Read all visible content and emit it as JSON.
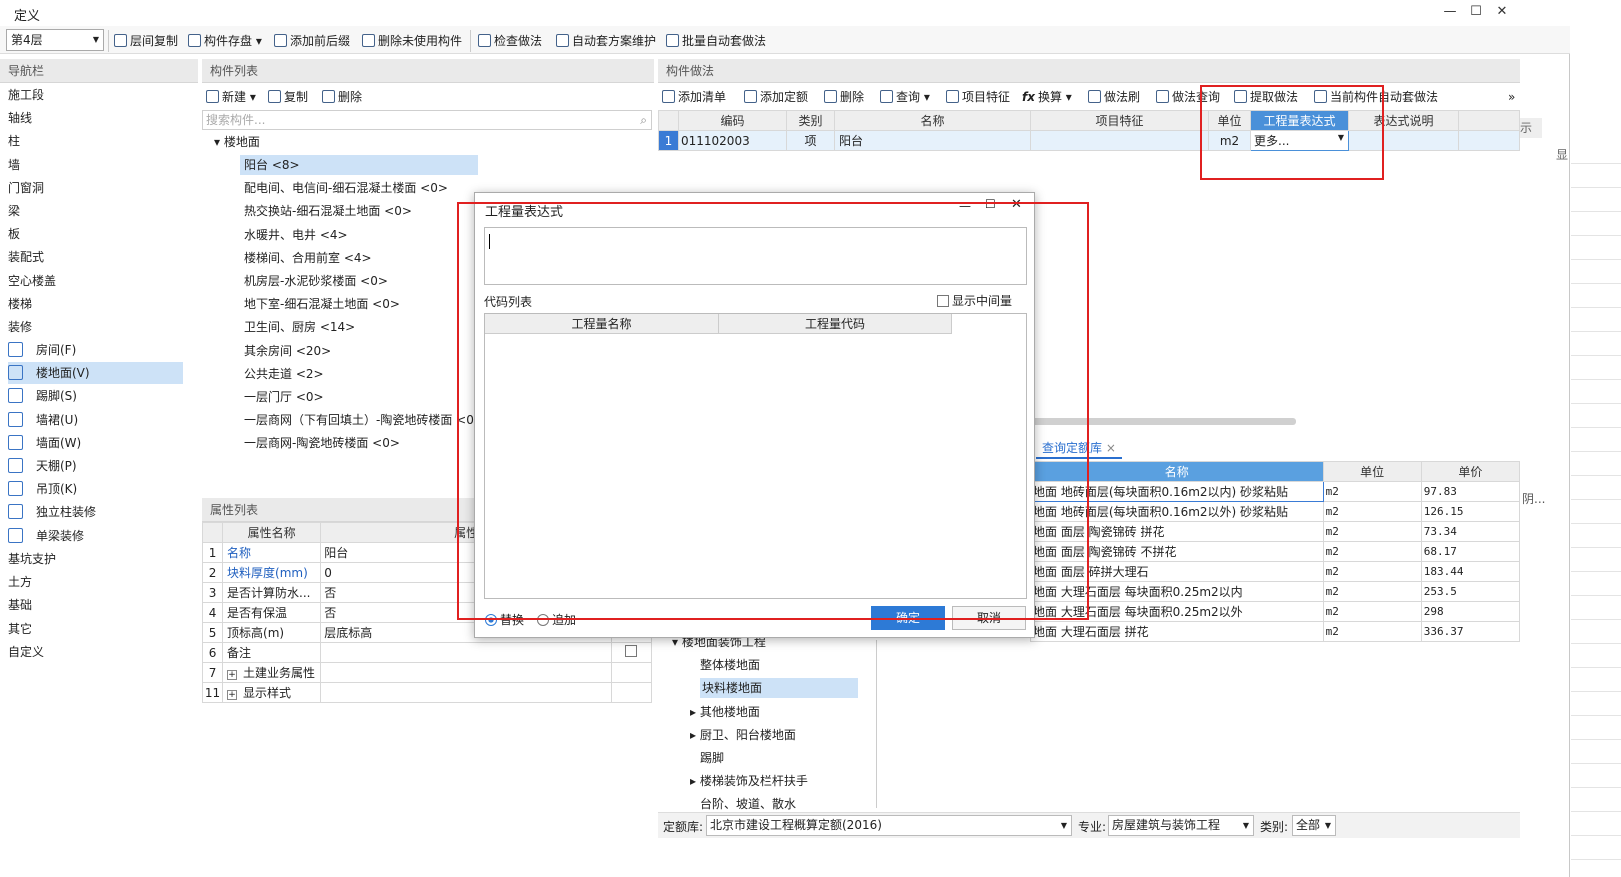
{
  "window": {
    "title": "定义"
  },
  "toolbar": {
    "floor": "第4层",
    "b1": "层间复制",
    "b2": "构件存盘",
    "b3": "添加前后缀",
    "b4": "删除未使用构件",
    "b5": "检查做法",
    "b6": "自动套方案维护",
    "b7": "批量自动套做法"
  },
  "nav": {
    "title": "导航栏",
    "items": [
      "施工段",
      "轴线",
      "柱",
      "墙",
      "门窗洞",
      "梁",
      "板",
      "装配式",
      "空心楼盖",
      "楼梯",
      "装修"
    ],
    "sub": [
      "房间(F)",
      "楼地面(V)",
      "踢脚(S)",
      "墙裙(U)",
      "墙面(W)",
      "天棚(P)",
      "吊顶(K)",
      "独立柱装修",
      "单梁装修"
    ],
    "items2": [
      "基坑支护",
      "土方",
      "基础",
      "其它",
      "自定义"
    ]
  },
  "comp": {
    "title": "构件列表",
    "new": "新建",
    "copy": "复制",
    "del": "删除",
    "search_ph": "搜索构件...",
    "root": "楼地面",
    "items": [
      "阳台 <8>",
      "配电间、电信间-细石混凝土楼面 <0>",
      "热交换站-细石混凝土地面 <0>",
      "水暖井、电井 <4>",
      "楼梯间、合用前室 <4>",
      "机房层-水泥砂浆楼面 <0>",
      "地下室-细石混凝土地面 <0>",
      "卫生间、厨房 <14>",
      "其余房间 <20>",
      "公共走道 <2>",
      "一层门厅 <0>",
      "一层商网（下有回填土）-陶瓷地砖楼面 <0>",
      "一层商网-陶瓷地砖楼面 <0>"
    ]
  },
  "props": {
    "title": "属性列表",
    "h1": "属性名称",
    "h2": "属性",
    "rows": [
      {
        "n": "1",
        "k": "名称",
        "v": "阳台"
      },
      {
        "n": "2",
        "k": "块料厚度(mm)",
        "v": "0"
      },
      {
        "n": "3",
        "k": "是否计算防水...",
        "v": "否"
      },
      {
        "n": "4",
        "k": "是否有保温",
        "v": "否"
      },
      {
        "n": "5",
        "k": "顶标高(m)",
        "v": "层底标高"
      },
      {
        "n": "6",
        "k": "备注",
        "v": ""
      },
      {
        "n": "7",
        "k": "土建业务属性",
        "v": ""
      },
      {
        "n": "11",
        "k": "显示样式",
        "v": ""
      }
    ]
  },
  "method": {
    "title": "构件做法",
    "b1": "添加清单",
    "b2": "添加定额",
    "b3": "删除",
    "b4": "查询",
    "b5": "项目特征",
    "b6": "换算",
    "b7": "做法刷",
    "b8": "做法查询",
    "b9": "提取做法",
    "b10": "当前构件自动套做法",
    "cols": [
      "编码",
      "类别",
      "名称",
      "项目特征",
      "单位",
      "工程量表达式",
      "表达式说明"
    ],
    "row": {
      "n": "1",
      "code": "011102003",
      "type": "项",
      "name": "阳台",
      "feature": "",
      "unit": "m2",
      "expr": "更多...",
      "desc": ""
    },
    "right_hint": "示",
    "right_hint2": "显"
  },
  "query": {
    "tab": "查询定额库",
    "close": "×",
    "cols": [
      "名称",
      "单位",
      "单价"
    ],
    "rows": [
      [
        "地面 地砖面层(每块面积0.16m2以内) 砂浆粘贴",
        "m2",
        "97.83"
      ],
      [
        "地面 地砖面层(每块面积0.16m2以外) 砂浆粘贴",
        "m2",
        "126.15"
      ],
      [
        "地面 面层 陶瓷锦砖 拼花",
        "m2",
        "73.34"
      ],
      [
        "地面 面层 陶瓷锦砖 不拼花",
        "m2",
        "68.17"
      ],
      [
        "地面 面层 碎拼大理石",
        "m2",
        "183.44"
      ],
      [
        "地面 大理石面层 每块面积0.25m2以内",
        "m2",
        "253.5"
      ],
      [
        "地面 大理石面层 每块面积0.25m2以外",
        "m2",
        "298"
      ],
      [
        "地面 大理石面层 拼花",
        "m2",
        "336.37"
      ]
    ],
    "tree": [
      "楼地面装饰工程",
      "整体楼地面",
      "块料楼地面",
      "其他楼地面",
      "厨卫、阳台楼地面",
      "踢脚",
      "楼梯装饰及栏杆扶手",
      "台阶、坡道、散水"
    ],
    "side": "阴..."
  },
  "bottom": {
    "lib_label": "定额库:",
    "lib": "北京市建设工程概算定额(2016)",
    "spec_label": "专业:",
    "spec": "房屋建筑与装饰工程",
    "cat_label": "类别:",
    "cat": "全部"
  },
  "dialog": {
    "title": "工程量表达式",
    "code_list": "代码列表",
    "show_mid": "显示中间量",
    "c1": "工程量名称",
    "c2": "工程量代码",
    "replace": "替换",
    "append": "追加",
    "ok": "确定",
    "cancel": "取消"
  }
}
